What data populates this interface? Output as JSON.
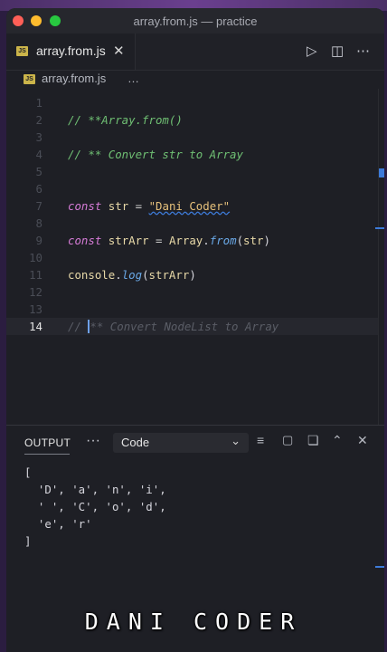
{
  "window": {
    "title": "array.from.js — practice"
  },
  "tab": {
    "badge": "JS",
    "label": "array.from.js",
    "close": "✕"
  },
  "toolbar": {
    "run_icon": "▷",
    "split_icon": "◫",
    "more_icon": "⋯"
  },
  "breadcrumb": {
    "badge": "JS",
    "file": "array.from.js",
    "more": "…"
  },
  "editor": {
    "line_numbers": [
      "1",
      "2",
      "3",
      "4",
      "5",
      "6",
      "7",
      "8",
      "9",
      "10",
      "11",
      "12",
      "13",
      "14"
    ],
    "lines": {
      "l2": "// **Array.from()",
      "l5": "// ** Convert str to Array",
      "l8": {
        "kw": "const",
        "var": "str",
        "op": "=",
        "str": "\"Dani Coder\""
      },
      "l10": {
        "kw": "const",
        "var": "strArr",
        "op": "=",
        "cls": "Array",
        "dot": ".",
        "fn": "from",
        "lp": "(",
        "arg": "str",
        "rp": ")"
      },
      "l12": {
        "obj": "console",
        "dot": ".",
        "fn": "log",
        "lp": "(",
        "arg": "strArr",
        "rp": ")"
      },
      "l14a": "// ",
      "l14b": "** Convert NodeList to Array"
    }
  },
  "panel": {
    "tab": "OUTPUT",
    "more": "···",
    "select_value": "Code",
    "output_lines": "[\n  'D', 'a', 'n', 'i',\n  ' ', 'C', 'o', 'd',\n  'e', 'r'\n]"
  },
  "watermark": "DANI CODER",
  "colors": {
    "accent": "#3d7bd9",
    "comment": "#6fbf73",
    "keyword": "#d57bd6",
    "string": "#e6c07b"
  }
}
